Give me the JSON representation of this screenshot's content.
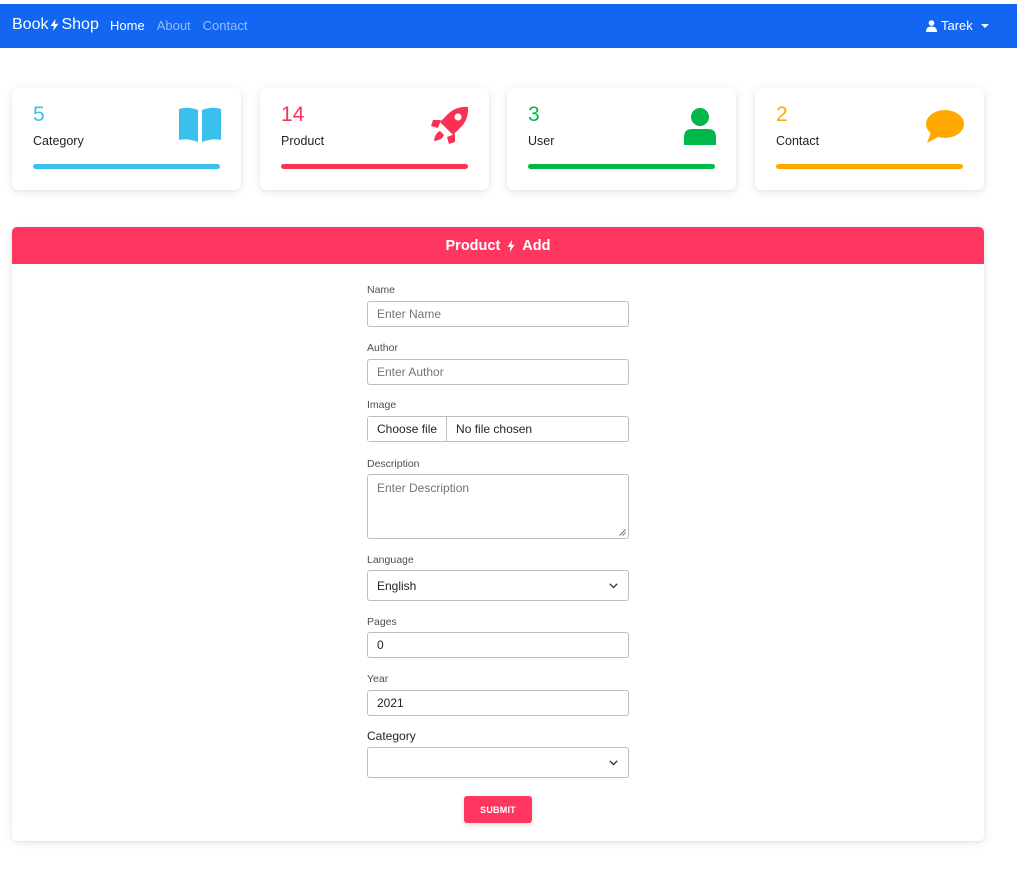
{
  "navbar": {
    "brand_left": "Book",
    "brand_right": "Shop",
    "links": [
      {
        "label": "Home",
        "active": true
      },
      {
        "label": "About",
        "active": false
      },
      {
        "label": "Contact",
        "active": false
      }
    ],
    "user": "Tarek",
    "color": "#1266f1"
  },
  "stats": [
    {
      "value": "5",
      "label": "Category",
      "color": "#39c0ed",
      "icon": "book-open-icon"
    },
    {
      "value": "14",
      "label": "Product",
      "color": "#f93154",
      "icon": "rocket-icon"
    },
    {
      "value": "3",
      "label": "User",
      "color": "#00b74a",
      "icon": "user-icon"
    },
    {
      "value": "2",
      "label": "Contact",
      "color": "#ffa900",
      "icon": "comment-icon"
    }
  ],
  "form": {
    "header_left": "Product",
    "header_right": "Add",
    "header_color": "#ff3660",
    "name": {
      "label": "Name",
      "placeholder": "Enter Name"
    },
    "author": {
      "label": "Author",
      "placeholder": "Enter Author"
    },
    "image": {
      "label": "Image",
      "button": "Choose file",
      "status": "No file chosen"
    },
    "description": {
      "label": "Description",
      "placeholder": "Enter Description"
    },
    "language": {
      "label": "Language",
      "value": "English"
    },
    "pages": {
      "label": "Pages",
      "value": "0"
    },
    "year": {
      "label": "Year",
      "value": "2021"
    },
    "category": {
      "label": "Category",
      "value": ""
    },
    "submit": "SUBMIT"
  }
}
